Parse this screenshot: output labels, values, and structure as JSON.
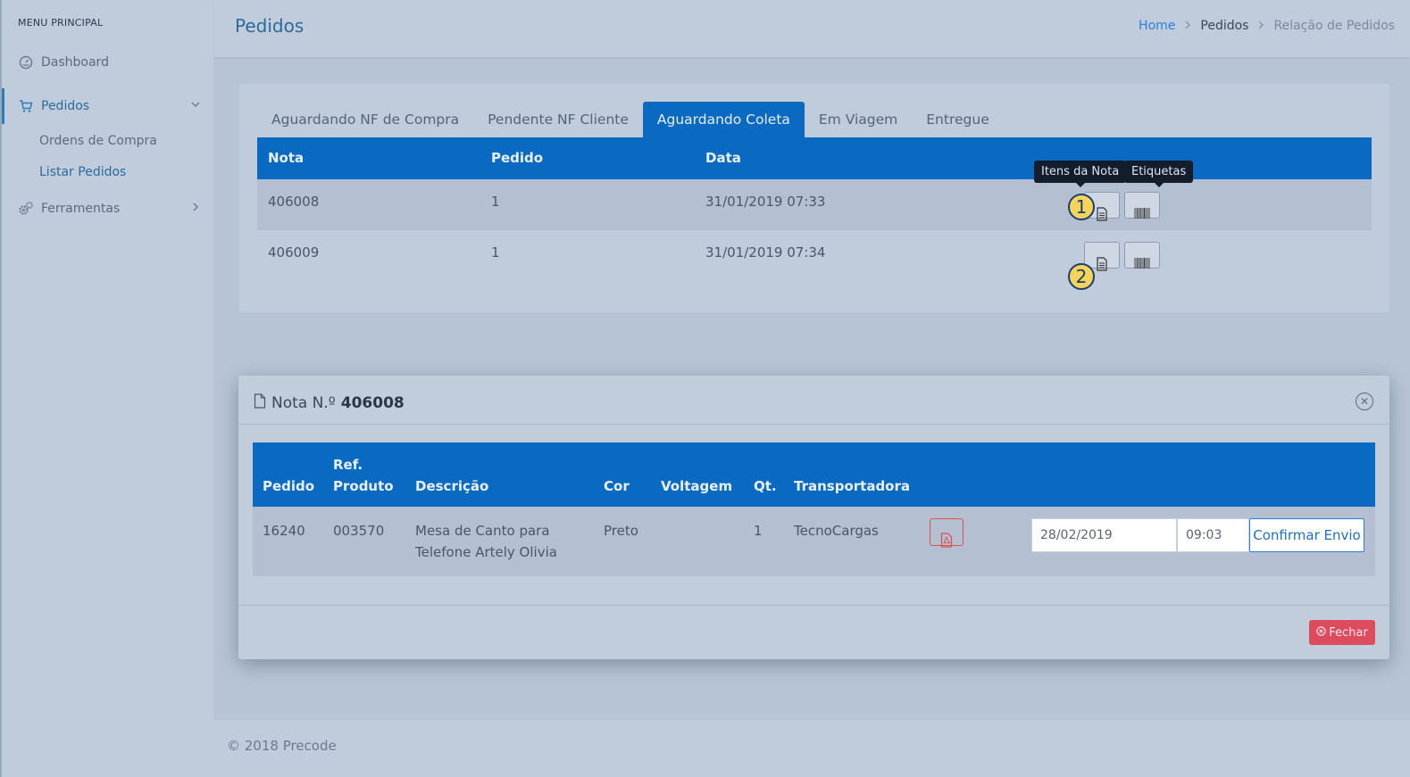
{
  "sidebar": {
    "title": "MENU PRINCIPAL",
    "items": [
      {
        "label": "Dashboard",
        "icon": "dashboard-icon"
      },
      {
        "label": "Pedidos",
        "icon": "cart-icon"
      },
      {
        "label": "Ferramentas",
        "icon": "gears-icon"
      }
    ],
    "subitems": [
      {
        "label": "Ordens de Compra"
      },
      {
        "label": "Listar Pedidos"
      }
    ]
  },
  "header": {
    "title": "Pedidos",
    "breadcrumb": {
      "home": "Home",
      "mid": "Pedidos",
      "current": "Relação de Pedidos"
    }
  },
  "tabs": [
    "Aguardando NF de Compra",
    "Pendente NF Cliente",
    "Aguardando Coleta",
    "Em Viagem",
    "Entregue"
  ],
  "orders_table": {
    "headers": {
      "nota": "Nota",
      "pedido": "Pedido",
      "data": "Data"
    },
    "rows": [
      {
        "nota": "406008",
        "pedido": "1",
        "data": "31/01/2019 07:33"
      },
      {
        "nota": "406009",
        "pedido": "1",
        "data": "31/01/2019 07:34"
      }
    ],
    "tooltips": {
      "itens": "Itens da Nota",
      "etiquetas": "Etiquetas"
    },
    "markers": [
      "1",
      "2"
    ]
  },
  "modal": {
    "title_prefix": "Nota N.º",
    "title_number": "406008",
    "headers": {
      "pedido": "Pedido",
      "ref_line1": "Ref.",
      "ref_line2": "Produto",
      "descricao": "Descrição",
      "cor": "Cor",
      "voltagem": "Voltagem",
      "qt": "Qt.",
      "transportadora": "Transportadora"
    },
    "row": {
      "pedido": "16240",
      "ref": "003570",
      "descricao_line1": "Mesa de Canto para",
      "descricao_line2": "Telefone Artely Olivia",
      "cor": "Preto",
      "voltagem": "",
      "qt": "1",
      "transportadora": "TecnoCargas",
      "date_value": "28/02/2019",
      "time_value": "09:03"
    },
    "confirm_label": "Confirmar Envio",
    "close_label": "Fechar"
  },
  "footer": {
    "text": "© 2018 Precode"
  },
  "colors": {
    "primary": "#0a6ac2",
    "danger": "#dc4c5c",
    "accent": "#2a7fd8"
  }
}
